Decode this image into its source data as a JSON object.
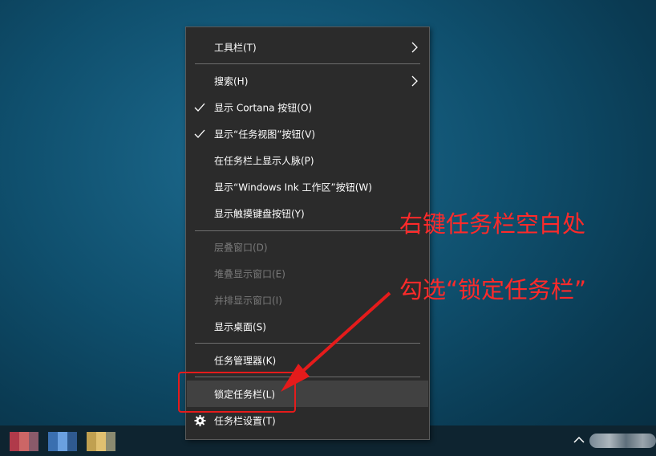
{
  "context_menu": {
    "items": [
      {
        "label": "工具栏(T)",
        "checked": false,
        "disabled": false,
        "submenu": true
      },
      {
        "label": "搜索(H)",
        "checked": false,
        "disabled": false,
        "submenu": true
      },
      {
        "label": "显示 Cortana 按钮(O)",
        "checked": true,
        "disabled": false,
        "submenu": false
      },
      {
        "label": "显示“任务视图”按钮(V)",
        "checked": true,
        "disabled": false,
        "submenu": false
      },
      {
        "label": "在任务栏上显示人脉(P)",
        "checked": false,
        "disabled": false,
        "submenu": false
      },
      {
        "label": "显示“Windows Ink 工作区”按钮(W)",
        "checked": false,
        "disabled": false,
        "submenu": false
      },
      {
        "label": "显示触摸键盘按钮(Y)",
        "checked": false,
        "disabled": false,
        "submenu": false
      },
      {
        "label": "层叠窗口(D)",
        "checked": false,
        "disabled": true,
        "submenu": false
      },
      {
        "label": "堆叠显示窗口(E)",
        "checked": false,
        "disabled": true,
        "submenu": false
      },
      {
        "label": "并排显示窗口(I)",
        "checked": false,
        "disabled": true,
        "submenu": false
      },
      {
        "label": "显示桌面(S)",
        "checked": false,
        "disabled": false,
        "submenu": false
      },
      {
        "label": "任务管理器(K)",
        "checked": false,
        "disabled": false,
        "submenu": false
      },
      {
        "label": "锁定任务栏(L)",
        "checked": false,
        "disabled": false,
        "submenu": false,
        "highlighted": true
      },
      {
        "label": "任务栏设置(T)",
        "checked": false,
        "disabled": false,
        "submenu": false,
        "icon": "gear-icon"
      }
    ]
  },
  "annotations": {
    "line1": "右键任务栏空白处",
    "line2": "勾选“锁定任务栏”"
  },
  "taskbar": {
    "tray_icon": "chevron-up-icon"
  },
  "colors": {
    "annotation": "#ff2a2a",
    "menu_bg": "#2b2b2b",
    "highlight": "#414141"
  }
}
